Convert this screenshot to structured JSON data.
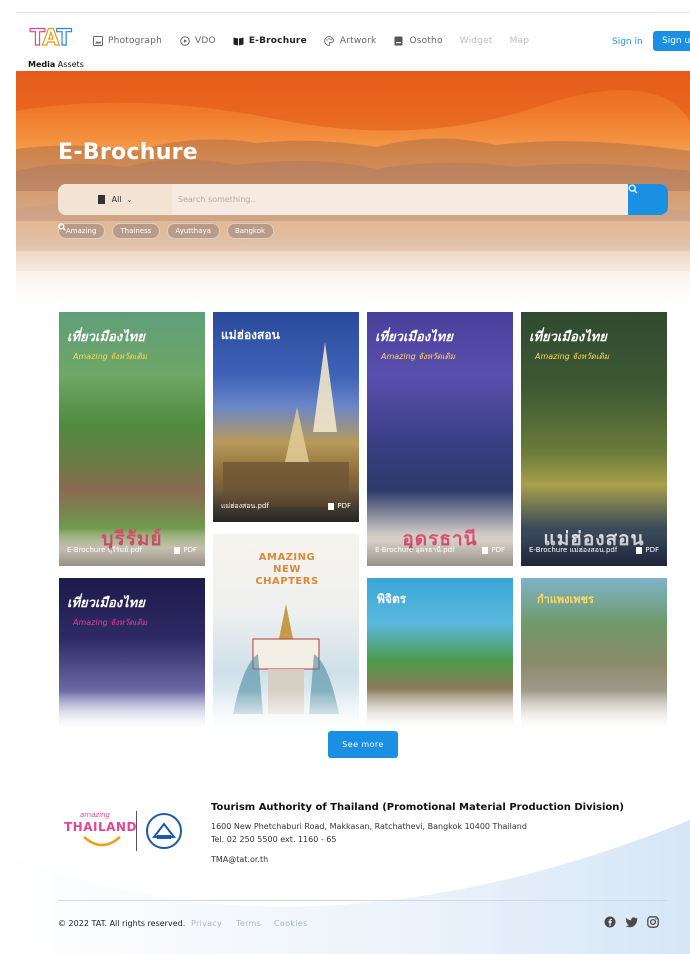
{
  "header": {
    "logo_text": "TAT",
    "logo_sub_bold": "Media",
    "logo_sub": " Assets",
    "nav": [
      {
        "label": "Photograph",
        "icon": "image-icon"
      },
      {
        "label": "VDO",
        "icon": "play-circle-icon"
      },
      {
        "label": "E-Brochure",
        "icon": "book-icon"
      },
      {
        "label": "Artwork",
        "icon": "palette-icon"
      },
      {
        "label": "Osotho",
        "icon": "file-icon"
      },
      {
        "label": "Widget",
        "icon": ""
      },
      {
        "label": "Map",
        "icon": ""
      }
    ],
    "active_nav": "E-Brochure",
    "signin": "Sign in",
    "signup": "Sign up"
  },
  "hero": {
    "title": "E-Brochure",
    "category": "All",
    "search_placeholder": "Search something..",
    "tags": [
      "Amazing",
      "Thainess",
      "Ayutthaya",
      "Bangkok"
    ]
  },
  "brochures": [
    {
      "name": "E-Brochure บุรีรัมย์.pdf",
      "type": "PDF",
      "cover_text": "บุรีรัมย์",
      "top_text": "เที่ยวเมืองไทย",
      "top_sub": "Amazing จังหวัดเดิม"
    },
    {
      "name": "แม่ฮ่องสอน.pdf",
      "type": "PDF",
      "cover_text": "",
      "top_text": "แม่ฮ่องสอน",
      "top_sub": ""
    },
    {
      "name": "E-Brochure อุดรธานี.pdf",
      "type": "PDF",
      "cover_text": "อุดรธานี",
      "top_text": "เที่ยวเมืองไทย",
      "top_sub": "Amazing จังหวัดเดิม"
    },
    {
      "name": "E-Brochure แม่ฮ่องสอน.pdf",
      "type": "PDF",
      "cover_text": "แม่ฮ่องสอน",
      "top_text": "เที่ยวเมืองไทย",
      "top_sub": "Amazing จังหวัดเดิม"
    },
    {
      "name": "",
      "type": "",
      "cover_text": "",
      "top_text": "เที่ยวเมืองไทย",
      "top_sub": "Amazing จังหวัดเดิม"
    },
    {
      "name": "",
      "type": "",
      "cover_text": "",
      "top_text": "AMAZING NEW CHAPTERS",
      "top_sub": ""
    },
    {
      "name": "",
      "type": "",
      "cover_text": "",
      "top_text": "พิจิตร",
      "top_sub": ""
    },
    {
      "name": "",
      "type": "",
      "cover_text": "",
      "top_text": "กำแพงเพชร",
      "top_sub": ""
    }
  ],
  "see_more": "See more",
  "footer": {
    "brand_small": "amazing",
    "brand_big": "THAILAND",
    "org": "Tourism Authority of Thailand (Promotional Material Production Division)",
    "address": "1600 New Phetchaburi Road, Makkasan, Ratchathevi, Bangkok 10400 Thailand",
    "tel": "Tel. 02 250 5500 ext. 1160 - 65",
    "email": "TMA@tat.or.th",
    "copyright": "© 2022 TAT. All rights reserved.",
    "links": [
      "Privacy",
      "Terms",
      "Cookies"
    ],
    "social": [
      "facebook-icon",
      "twitter-icon",
      "instagram-icon"
    ]
  },
  "colors": {
    "accent": "#1a8fe3",
    "active_text": "#222222",
    "muted": "#bdbdbd"
  }
}
